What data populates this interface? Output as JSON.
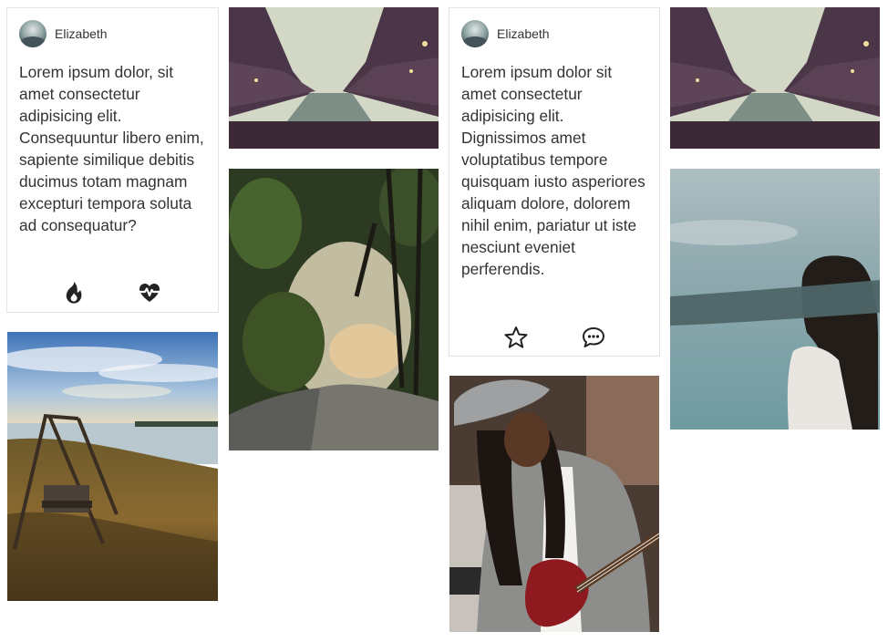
{
  "cards": [
    {
      "author": "Elizabeth",
      "text": "Lorem ipsum dolor, sit amet consectetur adipisicing elit. Consequuntur libero enim, sapiente similique debitis ducimus totam magnam excepturi tempora soluta ad consequatur?",
      "actions": [
        "fire-icon",
        "heartbeat-icon"
      ]
    },
    {
      "author": "Elizabeth",
      "text": "Lorem ipsum dolor sit amet consectetur adipisicing elit. Dignissimos amet voluptatibus tempore quisquam iusto asperiores aliquam dolore, dolorem nihil enim, pariatur ut iste nesciunt eveniet perferendis.",
      "actions": [
        "star-icon",
        "comment-icon"
      ]
    }
  ],
  "photos": [
    "canal-city-photo",
    "lake-swing-photo",
    "forest-rock-photo",
    "canal-city-photo",
    "guitar-woman-photo",
    "blindfold-woman-photo"
  ],
  "colors": {
    "border": "#e4e4e4",
    "icon": "#222222",
    "text": "#333333"
  }
}
